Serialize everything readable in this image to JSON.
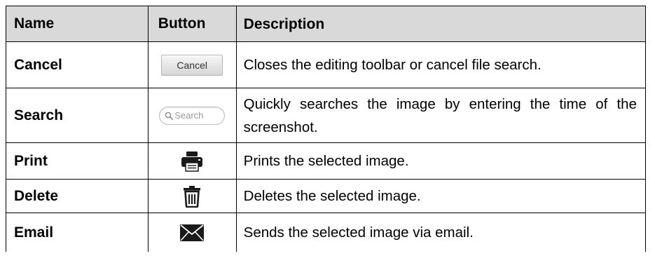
{
  "table": {
    "headers": {
      "name": "Name",
      "button": "Button",
      "description": "Description"
    },
    "rows": [
      {
        "name": "Cancel",
        "button": {
          "kind": "text-button",
          "label": "Cancel"
        },
        "description": "Closes the editing toolbar or cancel file search."
      },
      {
        "name": "Search",
        "button": {
          "kind": "search-field",
          "placeholder": "Search",
          "icon": "search-icon"
        },
        "description": "Quickly searches the image by entering the time of the screenshot."
      },
      {
        "name": "Print",
        "button": {
          "kind": "icon",
          "icon": "printer-icon"
        },
        "description": "Prints the selected image."
      },
      {
        "name": "Delete",
        "button": {
          "kind": "icon",
          "icon": "trash-icon"
        },
        "description": "Deletes the selected image."
      },
      {
        "name": "Email",
        "button": {
          "kind": "icon",
          "icon": "envelope-icon"
        },
        "description": "Sends the selected image via email."
      }
    ]
  },
  "colors": {
    "header_background": "#d9d9d9",
    "border": "#000000",
    "icon": "#1a1a1a"
  }
}
